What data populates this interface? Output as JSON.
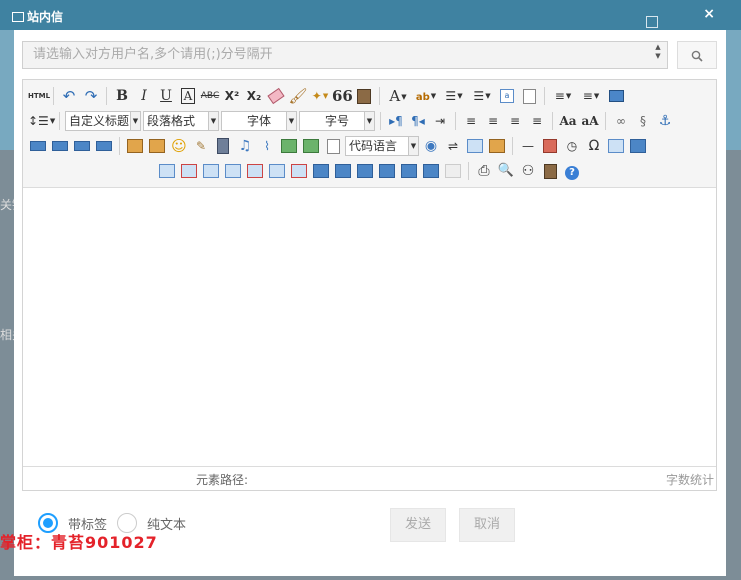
{
  "dialog": {
    "title": "站内信",
    "close_label": "×"
  },
  "recipient": {
    "placeholder": "请选输入对方用户名,多个请用(;)分号隔开",
    "search_icon": "search-icon"
  },
  "toolbar": {
    "row1": {
      "html_label": "HTML",
      "superscript_label": "X²",
      "subscript_label": "X₂",
      "quote_label": "66",
      "font_color_label": "A"
    },
    "row2": {
      "custom_title": "自定义标题",
      "paragraph_format": "段落格式",
      "font_family": "字体",
      "font_size": "字号",
      "omega_label": "Ω"
    },
    "row3": {
      "code_language": "代码语言"
    }
  },
  "status": {
    "element_path_label": "元素路径:",
    "word_count_label": "字数统计"
  },
  "format_options": [
    {
      "label": "带标签",
      "selected": true
    },
    {
      "label": "纯文本",
      "selected": false
    }
  ],
  "buttons": {
    "send": "发送",
    "cancel": "取消"
  },
  "watermark": "掌柜：青苔901027",
  "background_fragments": {
    "left1": "关键",
    "left2": "相关"
  },
  "colors": {
    "accent": "#1e9fff",
    "titlebar": "#3f82a1",
    "watermark": "#e4222a"
  }
}
